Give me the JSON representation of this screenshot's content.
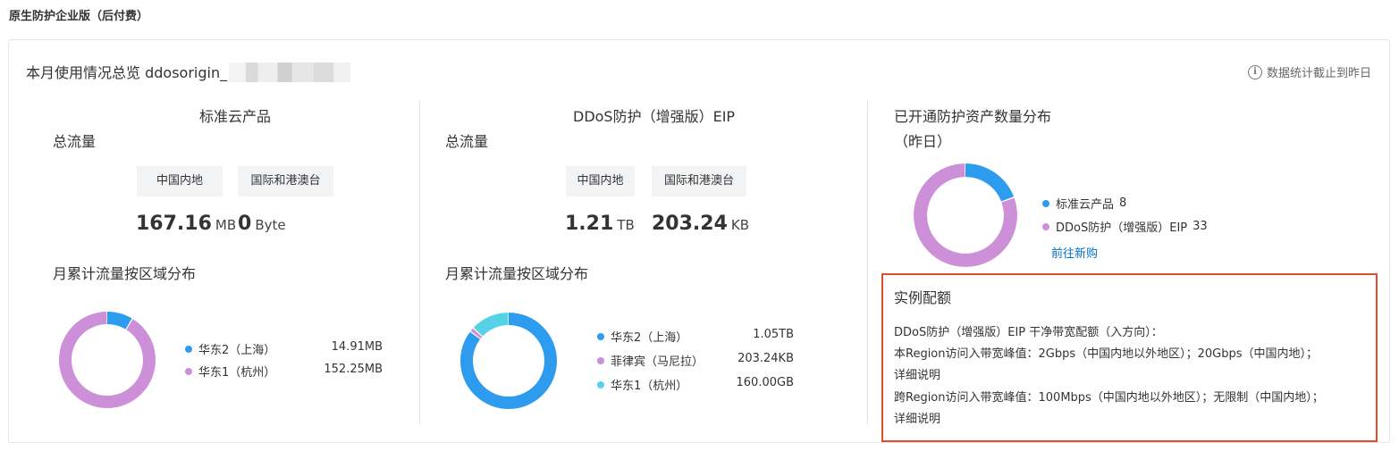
{
  "page_title": "原生防护企业版（后付费）",
  "card": {
    "title_prefix": "本月使用情况总览 ddosorigin_",
    "stat_note": "数据统计截止到昨日"
  },
  "col1": {
    "header": "标准云产品",
    "total_label": "总流量",
    "tabs": [
      "中国内地",
      "国际和港澳台"
    ],
    "values": [
      {
        "num": "167.16",
        "unit": "MB"
      },
      {
        "num": "0",
        "unit": "Byte"
      }
    ],
    "dist_title": "月累计流量按区域分布",
    "legend": [
      {
        "name": "华东2（上海）",
        "value": "14.91MB",
        "color": "#2d9cee",
        "share": 14.91
      },
      {
        "name": "华东1（杭州）",
        "value": "152.25MB",
        "color": "#cc8fd8",
        "share": 152.25
      }
    ]
  },
  "col2": {
    "header": "DDoS防护（增强版）EIP",
    "total_label": "总流量",
    "tabs": [
      "中国内地",
      "国际和港澳台"
    ],
    "values": [
      {
        "num": "1.21",
        "unit": "TB"
      },
      {
        "num": "203.24",
        "unit": "KB"
      }
    ],
    "dist_title": "月累计流量按区域分布",
    "legend": [
      {
        "name": "华东2（上海）",
        "value": "1.05TB",
        "color": "#2d9cee",
        "share": 1050
      },
      {
        "name": "菲律宾（马尼拉）",
        "value": "203.24KB",
        "color": "#cc8fd8",
        "share": 18
      },
      {
        "name": "华东1（杭州）",
        "value": "160.00GB",
        "color": "#55d2e6",
        "share": 160
      }
    ]
  },
  "col3": {
    "header_line1": "已开通防护资产数量分布",
    "header_line2": "（昨日）",
    "legend": [
      {
        "name": "标准云产品",
        "count": "8",
        "color": "#2d9cee",
        "share": 8
      },
      {
        "name": "DDoS防护（增强版）EIP",
        "count": "33",
        "color": "#cc8fd8",
        "share": 33
      }
    ],
    "buy_link": "前往新购"
  },
  "quota": {
    "title": "实例配额",
    "line1": "DDoS防护（增强版）EIP 干净带宽配额（入方向）：",
    "line2": "本Region访问入带宽峰值：2Gbps（中国内地以外地区）；20Gbps（中国内地）；",
    "link1": "详细说明",
    "line3": "跨Region访问入带宽峰值：100Mbps（中国内地以外地区）；无限制（中国内地）；",
    "link2": "详细说明"
  }
}
